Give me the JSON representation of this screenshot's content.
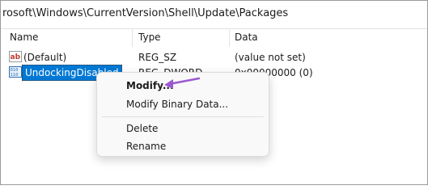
{
  "address": {
    "path": "rosoft\\Windows\\CurrentVersion\\Shell\\Update\\Packages"
  },
  "columns": {
    "name": "Name",
    "type": "Type",
    "data": "Data"
  },
  "rows": [
    {
      "name": "(Default)",
      "type": "REG_SZ",
      "data": "(value not set)",
      "icon": "string-value-icon"
    },
    {
      "name": "UndockingDisabled",
      "type": "REG_DWORD",
      "data": "0x00000000 (0)",
      "icon": "binary-value-icon"
    }
  ],
  "context_menu": {
    "items": [
      "Modify...",
      "Modify Binary Data...",
      "Delete",
      "Rename"
    ]
  },
  "colors": {
    "selection": "#0078d4",
    "annotation_arrow": "#9b59d0"
  }
}
